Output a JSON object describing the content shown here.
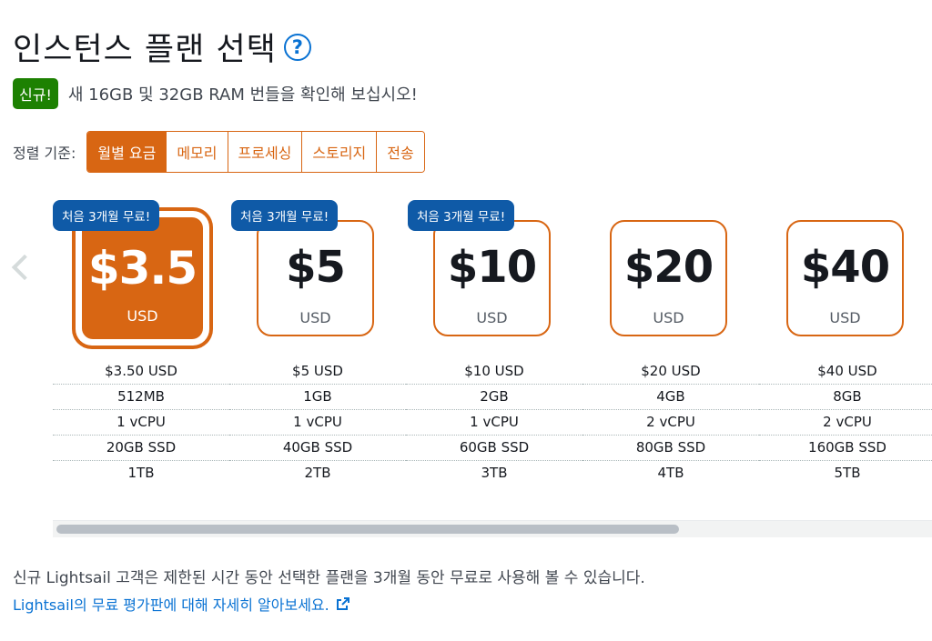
{
  "header": {
    "title": "인스턴스 플랜 선택",
    "help_icon": "?"
  },
  "news": {
    "badge": "신규!",
    "text": "새 16GB 및 32GB RAM 번들을 확인해 보십시오!",
    "badge_color": "#1d8102"
  },
  "sort": {
    "label": "정렬 기준:",
    "options": [
      "월별 요금",
      "메모리",
      "프로세싱",
      "스토리지",
      "전송"
    ],
    "selected": "월별 요금"
  },
  "plans": [
    {
      "promo": "처음 3개월 무료!",
      "price": "$3.5",
      "currency": "USD",
      "selected": true,
      "specs": [
        "$3.50 USD",
        "512MB",
        "1 vCPU",
        "20GB SSD",
        "1TB"
      ]
    },
    {
      "promo": "처음 3개월 무료!",
      "price": "$5",
      "currency": "USD",
      "selected": false,
      "specs": [
        "$5 USD",
        "1GB",
        "1 vCPU",
        "40GB SSD",
        "2TB"
      ]
    },
    {
      "promo": "처음 3개월 무료!",
      "price": "$10",
      "currency": "USD",
      "selected": false,
      "specs": [
        "$10 USD",
        "2GB",
        "1 vCPU",
        "60GB SSD",
        "3TB"
      ]
    },
    {
      "promo": "",
      "price": "$20",
      "currency": "USD",
      "selected": false,
      "specs": [
        "$20 USD",
        "4GB",
        "2 vCPU",
        "80GB SSD",
        "4TB"
      ]
    },
    {
      "promo": "",
      "price": "$40",
      "currency": "USD",
      "selected": false,
      "specs": [
        "$40 USD",
        "8GB",
        "2 vCPU",
        "160GB SSD",
        "5TB"
      ]
    }
  ],
  "footer": {
    "text": "신규 Lightsail 고객은 제한된 시간 동안 선택한 플랜을 3개월 동안 무료로 사용해 볼 수 있습니다.",
    "link": "Lightsail의 무료 평가판에 대해 자세히 알아보세요."
  },
  "colors": {
    "accent": "#d86613",
    "promo": "#0f5aa7",
    "link": "#0972d3"
  }
}
